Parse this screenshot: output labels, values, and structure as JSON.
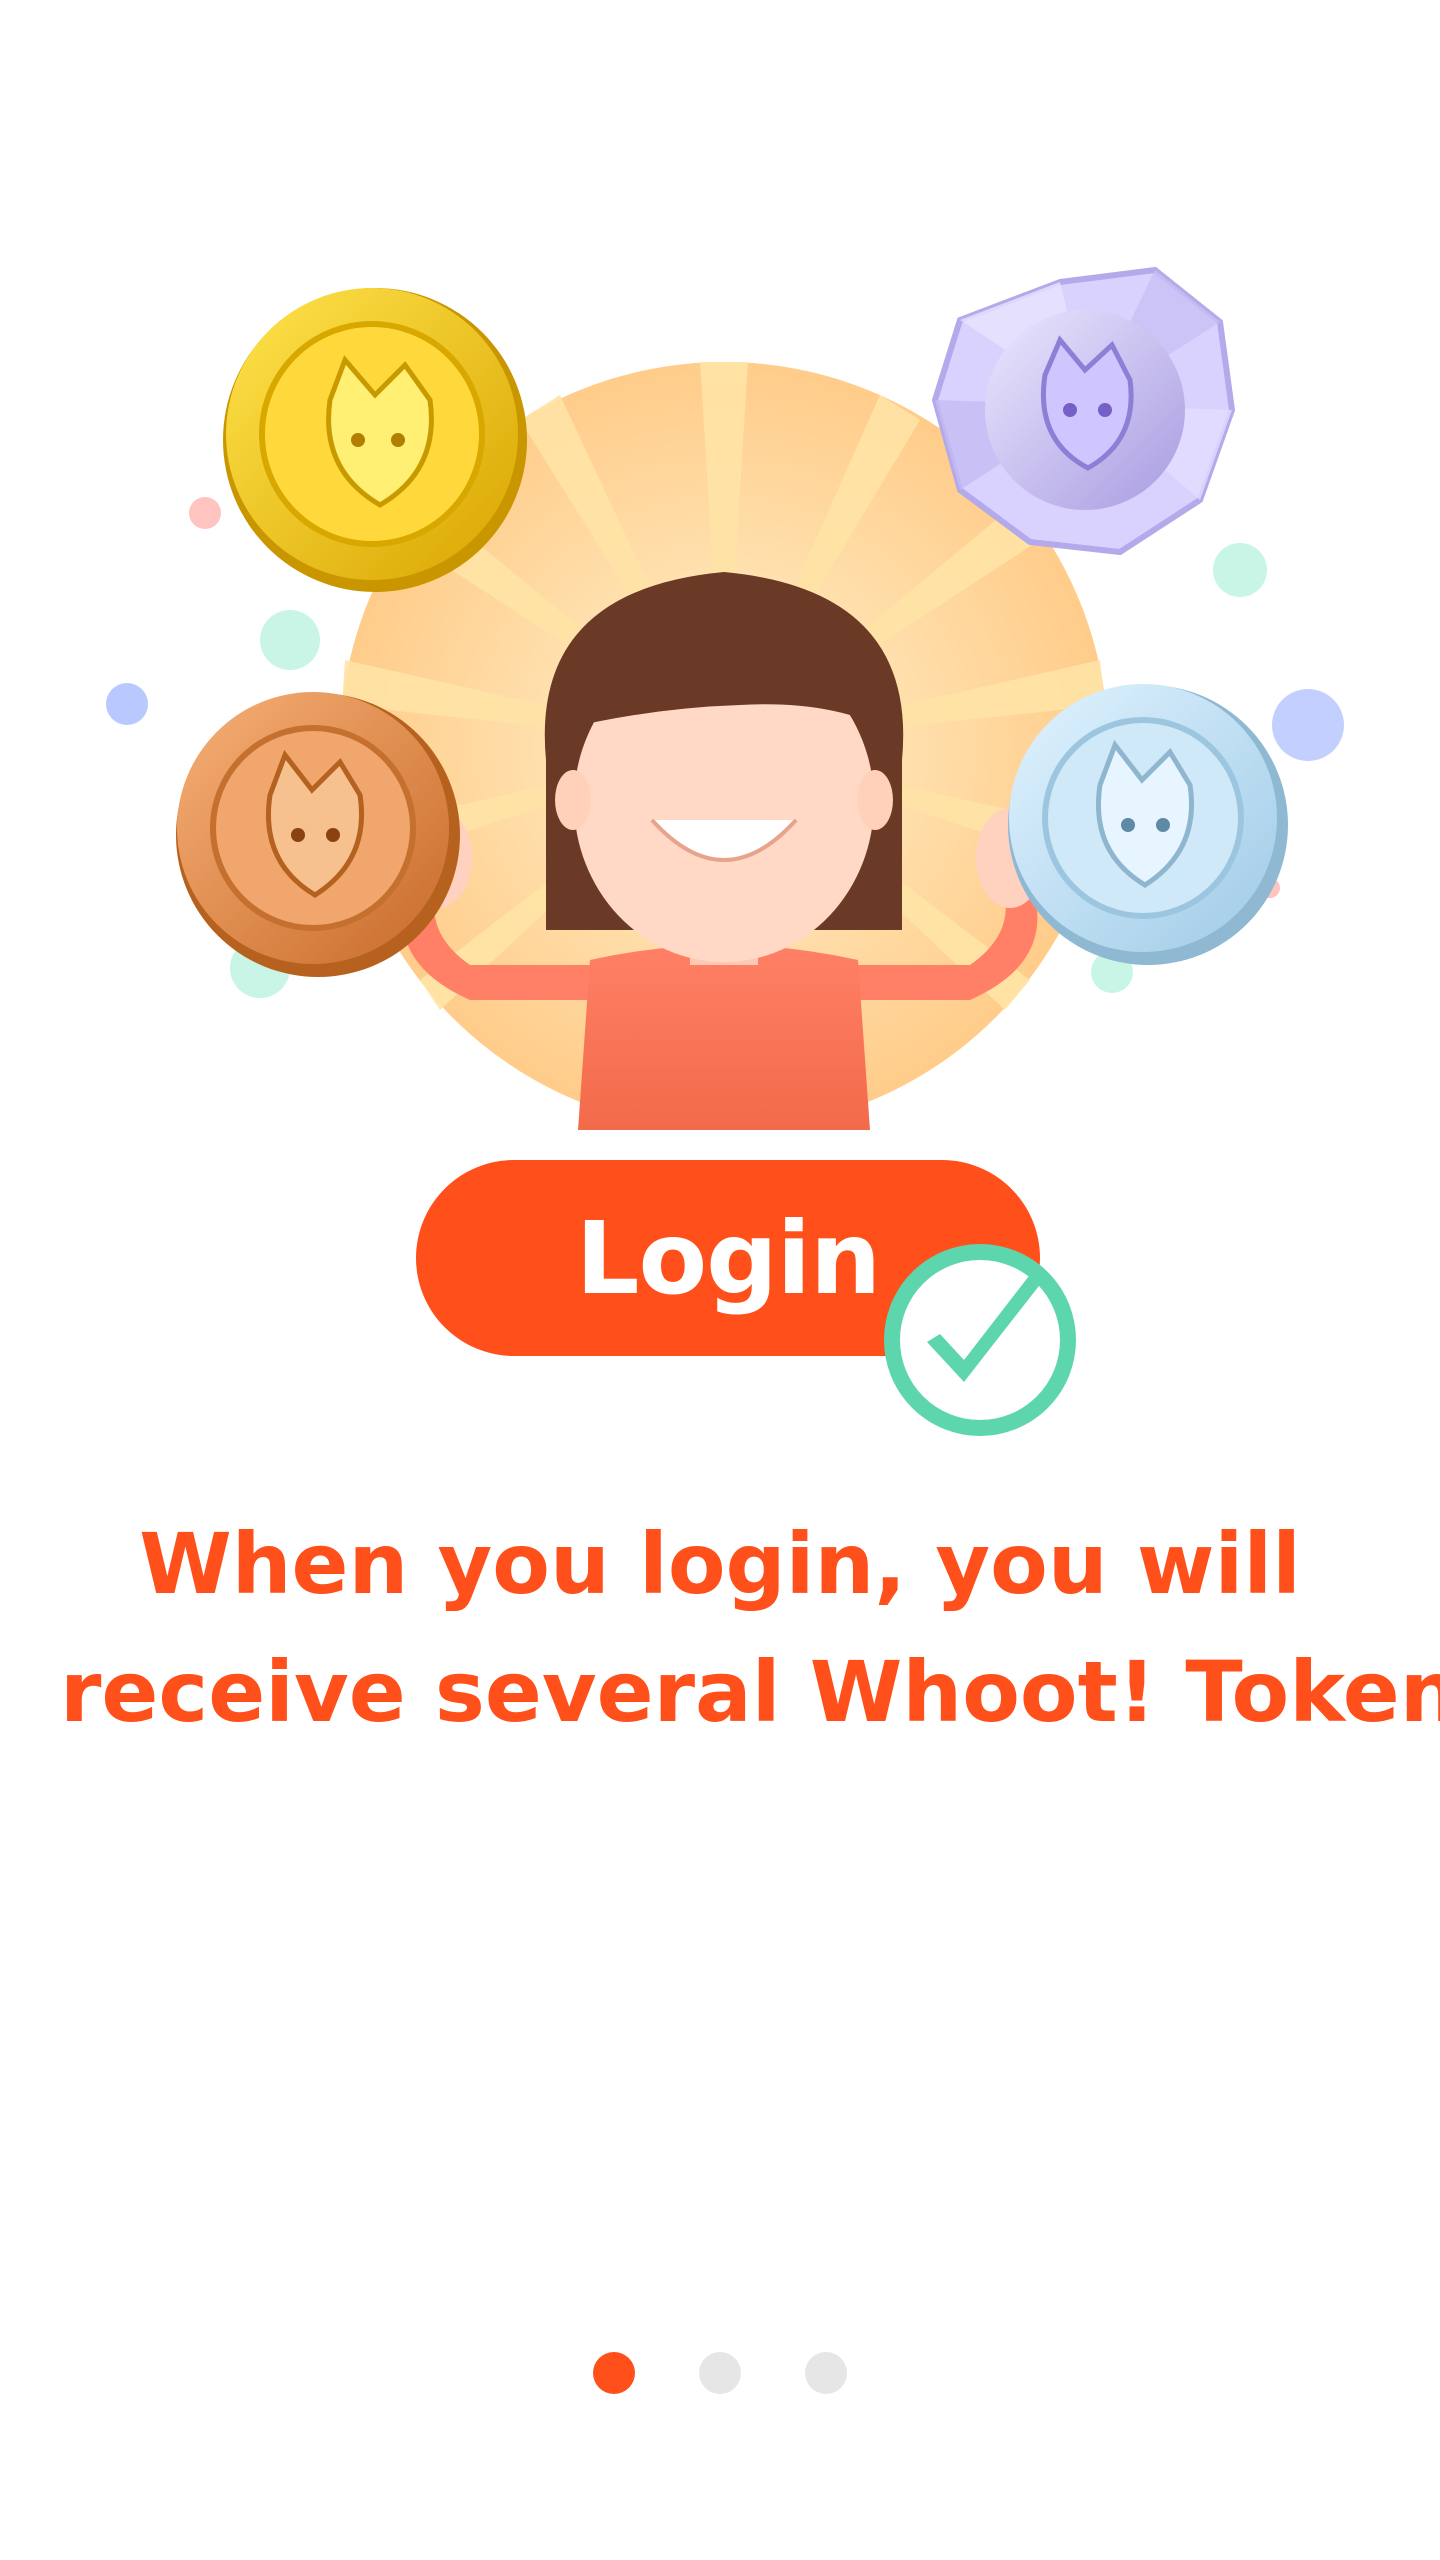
{
  "hero": {
    "gold_token_text": "Whoot Gold Token",
    "bronze_token_text": "Whoot Bronze Token",
    "silver_token_text": "Whoot Silver Token"
  },
  "login_button": {
    "label": "Login"
  },
  "caption": {
    "line1": "When you login, you will",
    "line2": "receive several Whoot! Tokens"
  },
  "pager": {
    "total": 3,
    "active_index": 0
  },
  "colors": {
    "accent": "#ff4f1a",
    "check_green": "#5ed6ad",
    "dot_inactive": "#e6e6e6",
    "gold": "#f2c200",
    "bronze": "#e08a4a",
    "silver": "#bfe0f3",
    "diamond": "#b9aee9"
  },
  "icons": [
    "gold-token-icon",
    "diamond-token-icon",
    "bronze-token-icon",
    "silver-token-icon",
    "girl-illustration",
    "check-icon"
  ]
}
